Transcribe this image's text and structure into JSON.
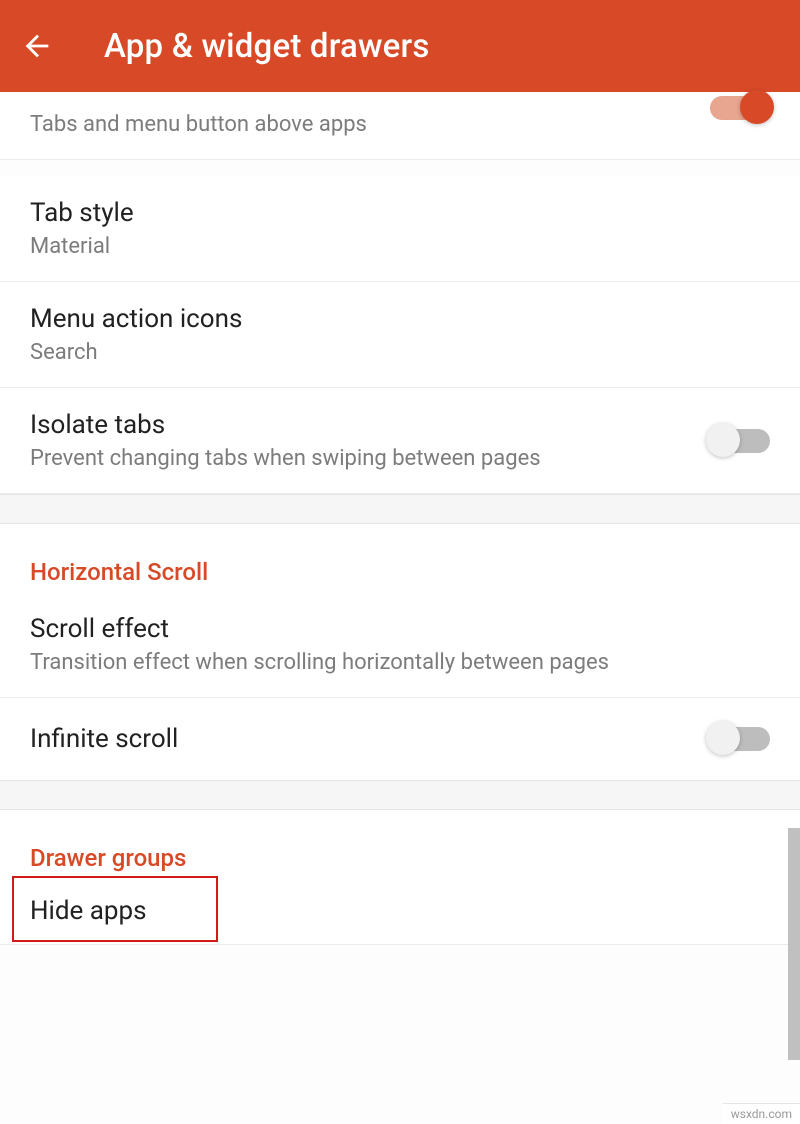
{
  "header": {
    "title": "App & widget drawers"
  },
  "items": {
    "tabs_menu": {
      "sub": "Tabs and menu button above apps"
    },
    "tab_style": {
      "title": "Tab style",
      "sub": "Material"
    },
    "menu_action": {
      "title": "Menu action icons",
      "sub": "Search"
    },
    "isolate": {
      "title": "Isolate tabs",
      "sub": "Prevent changing tabs when swiping between pages"
    },
    "scroll_effect": {
      "title": "Scroll effect",
      "sub": "Transition effect when scrolling horizontally between pages"
    },
    "infinite": {
      "title": "Infinite scroll"
    },
    "hide_apps": {
      "title": "Hide apps"
    }
  },
  "sections": {
    "horizontal": "Horizontal Scroll",
    "drawer_groups": "Drawer groups"
  },
  "footer": "wsxdn.com"
}
